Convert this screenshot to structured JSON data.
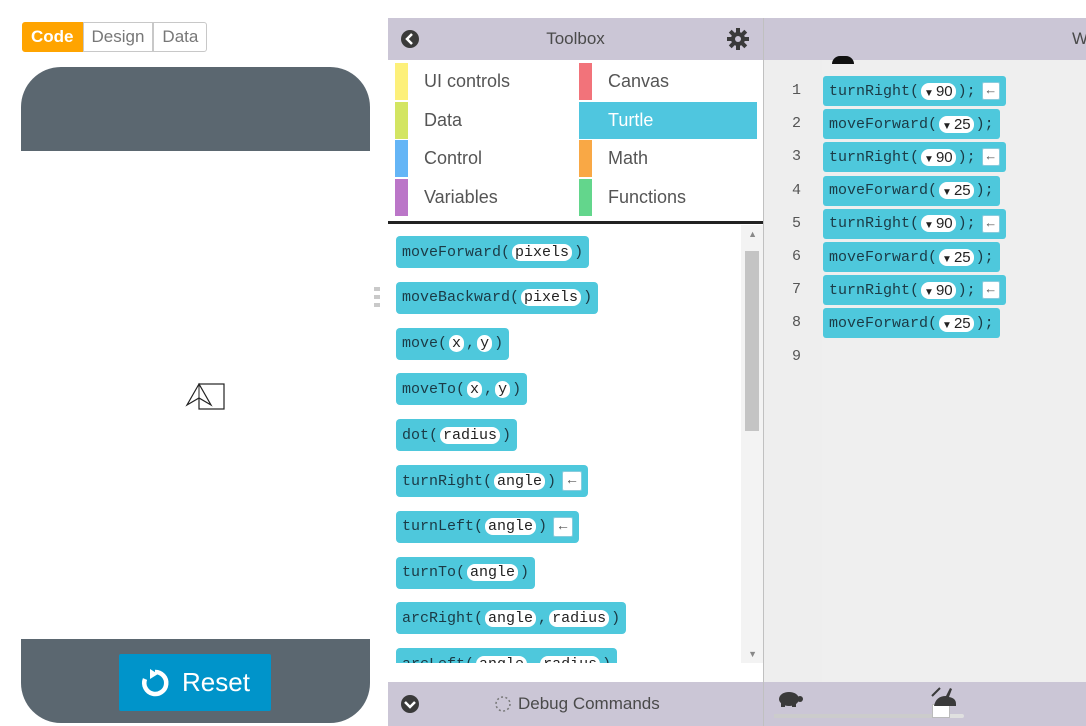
{
  "mode_toggle": {
    "code": "Code",
    "design": "Design",
    "data": "Data"
  },
  "colors": {
    "accent_orange": "#ffa400",
    "reset_blue": "#0094ca",
    "block_cyan": "#4ec8dc",
    "header_lavender": "#cbc6d6",
    "phone_frame": "#5b6770"
  },
  "app": {
    "reset_label": "Reset"
  },
  "toolbox": {
    "title": "Toolbox",
    "categories": [
      {
        "label": "UI controls",
        "color": "#fdf07a"
      },
      {
        "label": "Canvas",
        "color": "#f2737a"
      },
      {
        "label": "Data",
        "color": "#d3e562"
      },
      {
        "label": "Turtle",
        "color": "#4fc6df",
        "selected": true
      },
      {
        "label": "Control",
        "color": "#64b5f6"
      },
      {
        "label": "Math",
        "color": "#f9a845"
      },
      {
        "label": "Variables",
        "color": "#bb76c8"
      },
      {
        "label": "Functions",
        "color": "#63d68c"
      }
    ],
    "blocks": [
      {
        "name": "moveForward",
        "args": [
          "pixels"
        ],
        "return_arrow": false
      },
      {
        "name": "moveBackward",
        "args": [
          "pixels"
        ],
        "return_arrow": false
      },
      {
        "name": "move",
        "args": [
          "x",
          "y"
        ],
        "return_arrow": false
      },
      {
        "name": "moveTo",
        "args": [
          "x",
          "y"
        ],
        "return_arrow": false
      },
      {
        "name": "dot",
        "args": [
          "radius"
        ],
        "return_arrow": false
      },
      {
        "name": "turnRight",
        "args": [
          "angle"
        ],
        "return_arrow": true
      },
      {
        "name": "turnLeft",
        "args": [
          "angle"
        ],
        "return_arrow": true
      },
      {
        "name": "turnTo",
        "args": [
          "angle"
        ],
        "return_arrow": false
      },
      {
        "name": "arcRight",
        "args": [
          "angle",
          "radius"
        ],
        "return_arrow": false
      },
      {
        "name": "arcLeft",
        "args": [
          "angle",
          "radius"
        ],
        "return_arrow": false
      }
    ],
    "scroll_position": 0.05
  },
  "debug": {
    "label": "Debug Commands"
  },
  "workspace": {
    "title": "W",
    "line_numbers": [
      "1",
      "2",
      "3",
      "4",
      "5",
      "6",
      "7",
      "8",
      "9"
    ],
    "code_blocks": [
      {
        "name": "turnRight",
        "value": "90",
        "return_arrow": true
      },
      {
        "name": "moveForward",
        "value": "25",
        "return_arrow": false
      },
      {
        "name": "turnRight",
        "value": "90",
        "return_arrow": true
      },
      {
        "name": "moveForward",
        "value": "25",
        "return_arrow": false
      },
      {
        "name": "turnRight",
        "value": "90",
        "return_arrow": true
      },
      {
        "name": "moveForward",
        "value": "25",
        "return_arrow": false
      },
      {
        "name": "turnRight",
        "value": "90",
        "return_arrow": true
      },
      {
        "name": "moveForward",
        "value": "25",
        "return_arrow": false
      }
    ],
    "speed_slider_value": 0.88
  }
}
